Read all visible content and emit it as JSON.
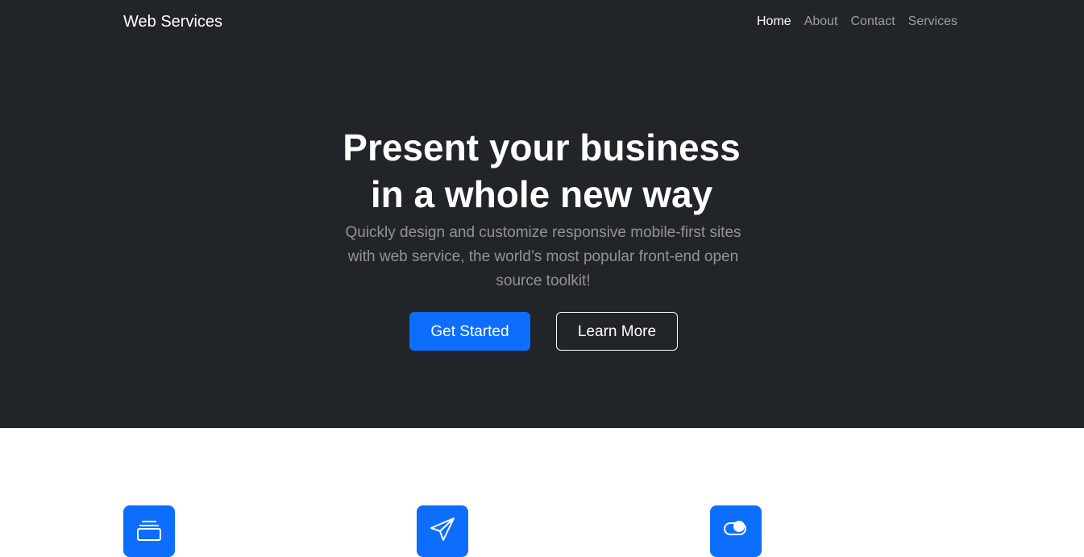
{
  "navbar": {
    "brand": "Web Services",
    "links": [
      {
        "label": "Home",
        "active": true
      },
      {
        "label": "About",
        "active": false
      },
      {
        "label": "Contact",
        "active": false
      },
      {
        "label": "Services",
        "active": false
      }
    ]
  },
  "hero": {
    "title_line1": "Present your business",
    "title_line2": "in a whole new way",
    "lead": "Quickly design and customize responsive mobile-first sites with web service, the world’s most popular front-end open source toolkit!",
    "primary_button": "Get Started",
    "secondary_button": "Learn More"
  },
  "features": {
    "icons": [
      "collection-icon",
      "send-icon",
      "toggles-icon"
    ]
  },
  "colors": {
    "dark_bg": "#212529",
    "accent": "#0d6efd"
  }
}
